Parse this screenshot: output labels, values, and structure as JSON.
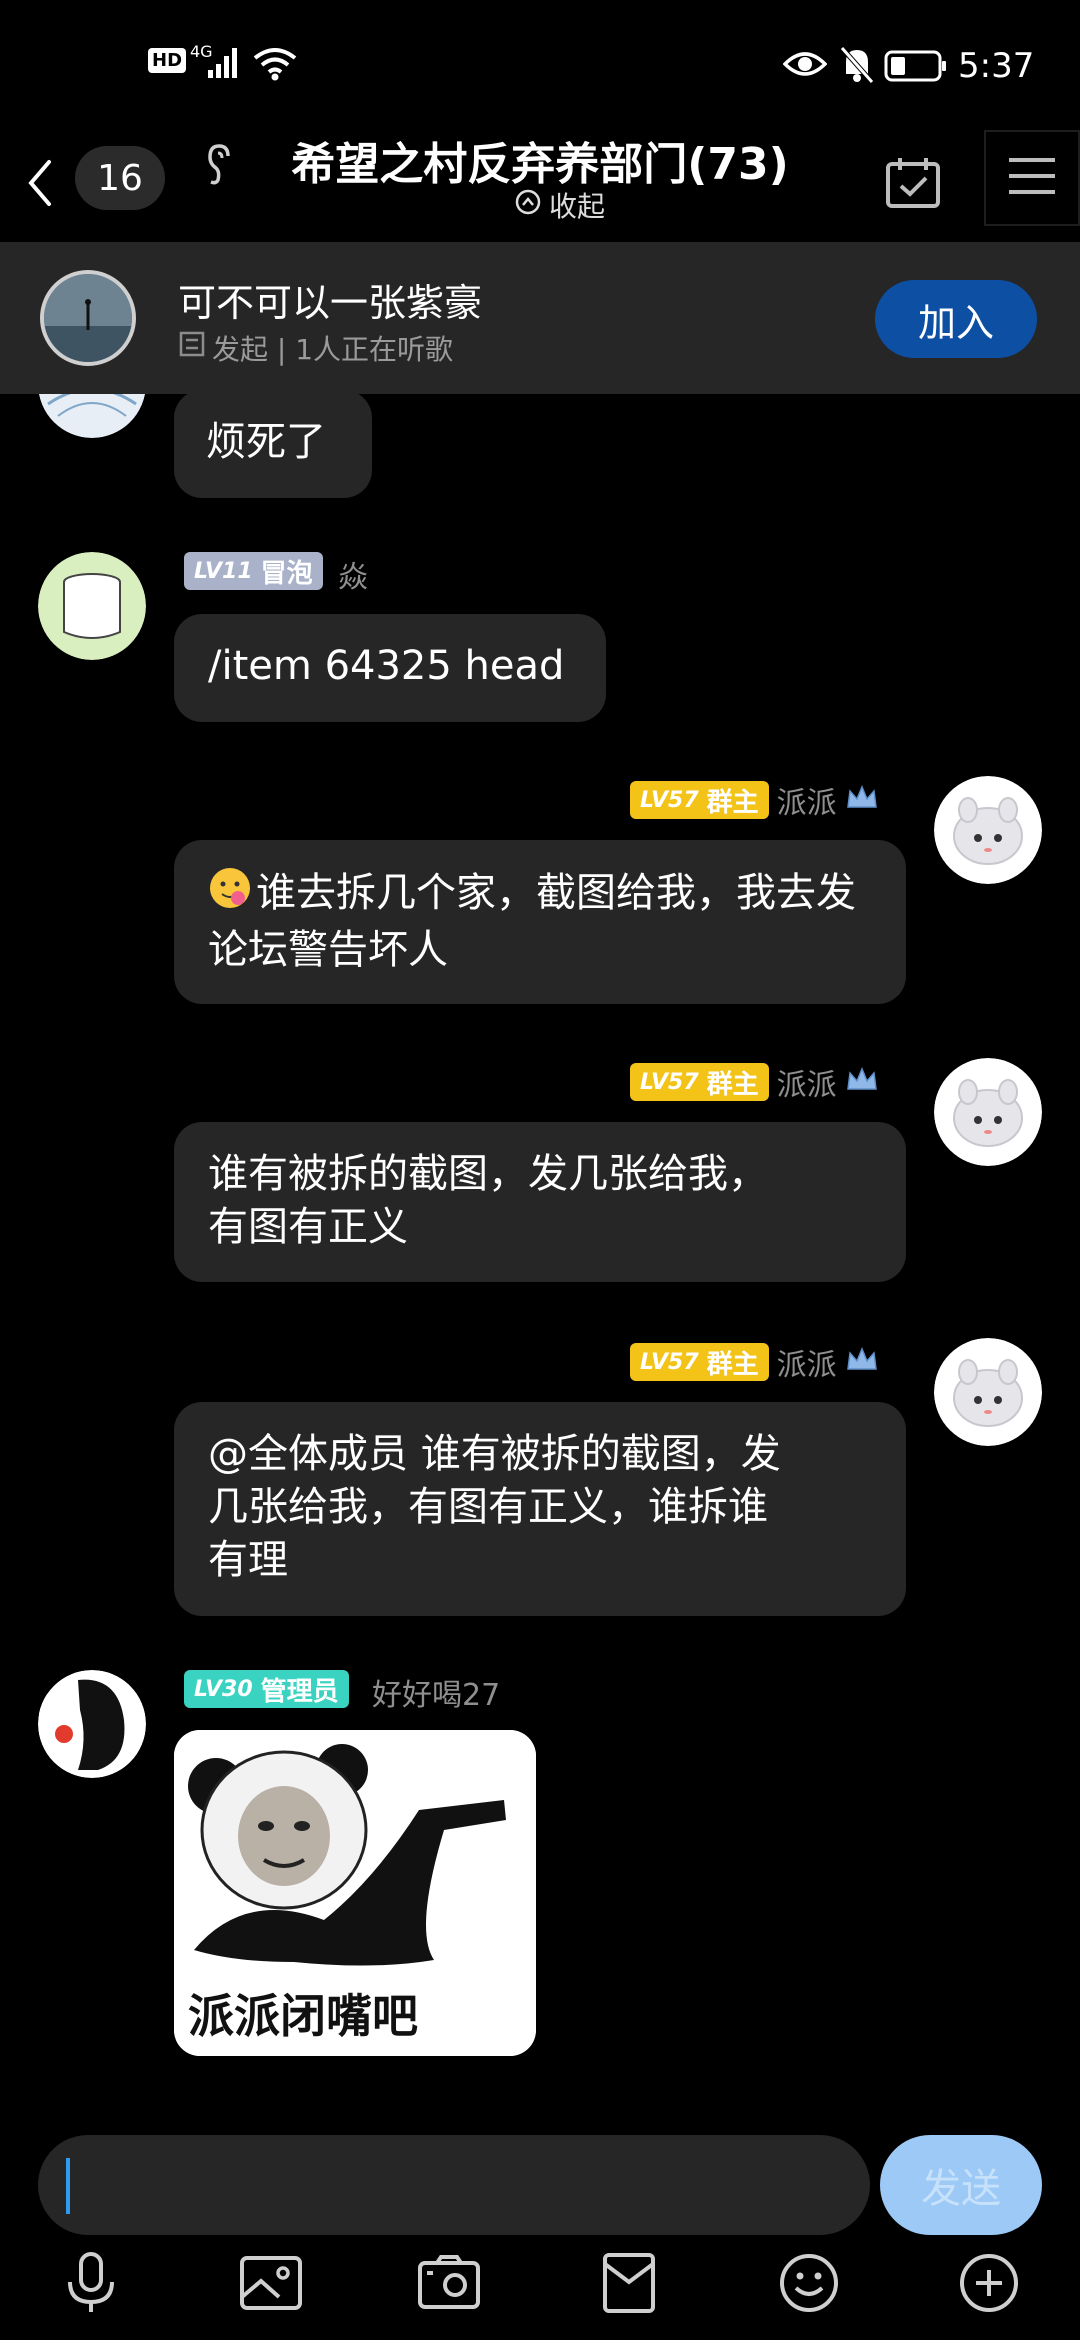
{
  "status_bar": {
    "left_icons": [
      "hd-icon",
      "4g-signal-icon",
      "wifi-icon"
    ],
    "hd": "HD",
    "net": "4G",
    "right_icons": [
      "eye-icon",
      "bell-muted-icon",
      "battery-icon"
    ],
    "time": "5:37"
  },
  "header": {
    "unread_count": "16",
    "title": "希望之村反弃养部门(73)",
    "collapse_label": "收起"
  },
  "music_bar": {
    "title": "可不可以一张紫豪",
    "subtitle": "发起 | 1人正在听歌",
    "join_label": "加入"
  },
  "messages": [
    {
      "side": "left",
      "text": "烦死了"
    },
    {
      "side": "left",
      "level": "LV11",
      "role": "冒泡",
      "role_color": "#a9b2c8",
      "nick": "焱",
      "text": "/item 64325 head"
    },
    {
      "side": "right",
      "level": "LV57",
      "role": "群主",
      "role_color": "#f3c318",
      "nick": "派派",
      "text": "谁去拆几个家，截图给我，我去发论坛警告坏人"
    },
    {
      "side": "right",
      "level": "LV57",
      "role": "群主",
      "role_color": "#f3c318",
      "nick": "派派",
      "text_line1": "谁有被拆的截图，发几张给我，",
      "text_line2": "有图有正义"
    },
    {
      "side": "right",
      "level": "LV57",
      "role": "群主",
      "role_color": "#f3c318",
      "nick": "派派",
      "text_line1": "@全体成员 谁有被拆的截图，发",
      "text_line2": "几张给我，有图有正义，谁拆谁",
      "text_line3": "有理"
    },
    {
      "side": "left",
      "level": "LV30",
      "role": "管理员",
      "role_color": "#3ad3c1",
      "nick": "好好喝27",
      "sticker_caption": "派派闭嘴吧"
    }
  ],
  "input": {
    "send_label": "发送"
  },
  "toolbar": [
    "microphone-icon",
    "image-icon",
    "camera-icon",
    "red-packet-icon",
    "emoji-icon",
    "plus-icon"
  ]
}
